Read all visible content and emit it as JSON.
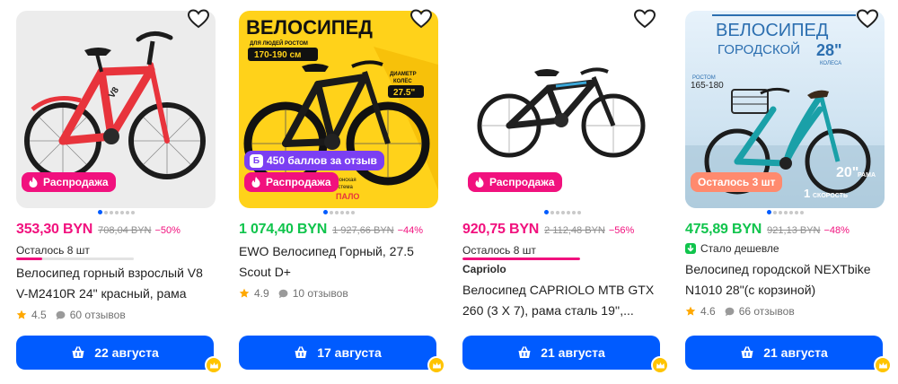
{
  "colors": {
    "accent": "#005bff",
    "sale_pink": "#f1117e",
    "price_green": "#10c44c",
    "points_purple": "#7b3ff2",
    "stock_badge": "#ff8a6e",
    "crown_yellow": "#ffc400",
    "star": "#ffa800"
  },
  "icons": [
    "heart-outline-icon",
    "flame-icon",
    "basket-icon",
    "crown-icon",
    "star-icon",
    "review-bubble-icon",
    "price-down-icon"
  ],
  "products": [
    {
      "image_alt": "red bicycle",
      "badge": "Распродажа",
      "price": "353,30 BYN",
      "old_price": "708,04 BYN",
      "discount": "−50%",
      "stock": "Осталось 8 шт",
      "stock_level": 0.22,
      "title": "Велосипед горный взрослый V8 V-M2410R 24\" красный, рама 17\",...",
      "rating": "4.5",
      "reviews": "60 отзывов",
      "delivery": "22 августа"
    },
    {
      "image_alt": "black mountain bicycle",
      "image_text": {
        "headline": "ВЕЛОСИПЕД",
        "height_caption": "ДЛЯ ЛЮДЕЙ РОСТОМ",
        "height_range": "170-190 см",
        "wheel_caption_1": "ДИАМЕТР",
        "wheel_caption_2": "КОЛЁС",
        "wheel_size": "27.5\"",
        "bottom_caption_1": "Японская",
        "bottom_caption_2": "система",
        "bottom_caption_3": "ПАЛО"
      },
      "points_box": "Б",
      "points_badge": "450 баллов за отзыв",
      "badge": "Распродажа",
      "price": "1 074,40 BYN",
      "old_price": "1 927,66 BYN",
      "discount": "−44%",
      "title": "EWO Велосипед Горный, 27.5 Scout D+",
      "rating": "4.9",
      "reviews": "10 отзывов",
      "delivery": "17 августа"
    },
    {
      "image_alt": "black full-suspension bicycle",
      "badge": "Распродажа",
      "price": "920,75 BYN",
      "old_price": "2 112,48 BYN",
      "discount": "−56%",
      "stock": "Осталось 8 шт",
      "stock_level": 1,
      "brand": "Capriolo",
      "title": "Велосипед CAPRIOLO MTB GTX 260 (3 X 7), рама сталь 19'',...",
      "delivery": "21 августа"
    },
    {
      "image_alt": "turquoise city bicycle with basket",
      "image_text": {
        "line1": "ВЕЛОСИПЕД",
        "line2": "ГОРОДСКОЙ",
        "size": "28\"",
        "size_caption": "КОЛЕСА",
        "height_caption": "РОСТОМ",
        "height_range": "165-180",
        "frame_size": "20\"",
        "frame_caption": "РАМА",
        "speed_number": "1",
        "speed_caption": "СКОРОСТЬ"
      },
      "badge": "Осталось 3 шт",
      "price": "475,89 BYN",
      "old_price": "921,13 BYN",
      "discount": "−48%",
      "cheaper": "Стало дешевле",
      "title": "Велосипед городской NEXTbike N1010 28\"(с корзиной)",
      "rating": "4.6",
      "reviews": "66 отзывов",
      "delivery": "21 августа"
    }
  ]
}
